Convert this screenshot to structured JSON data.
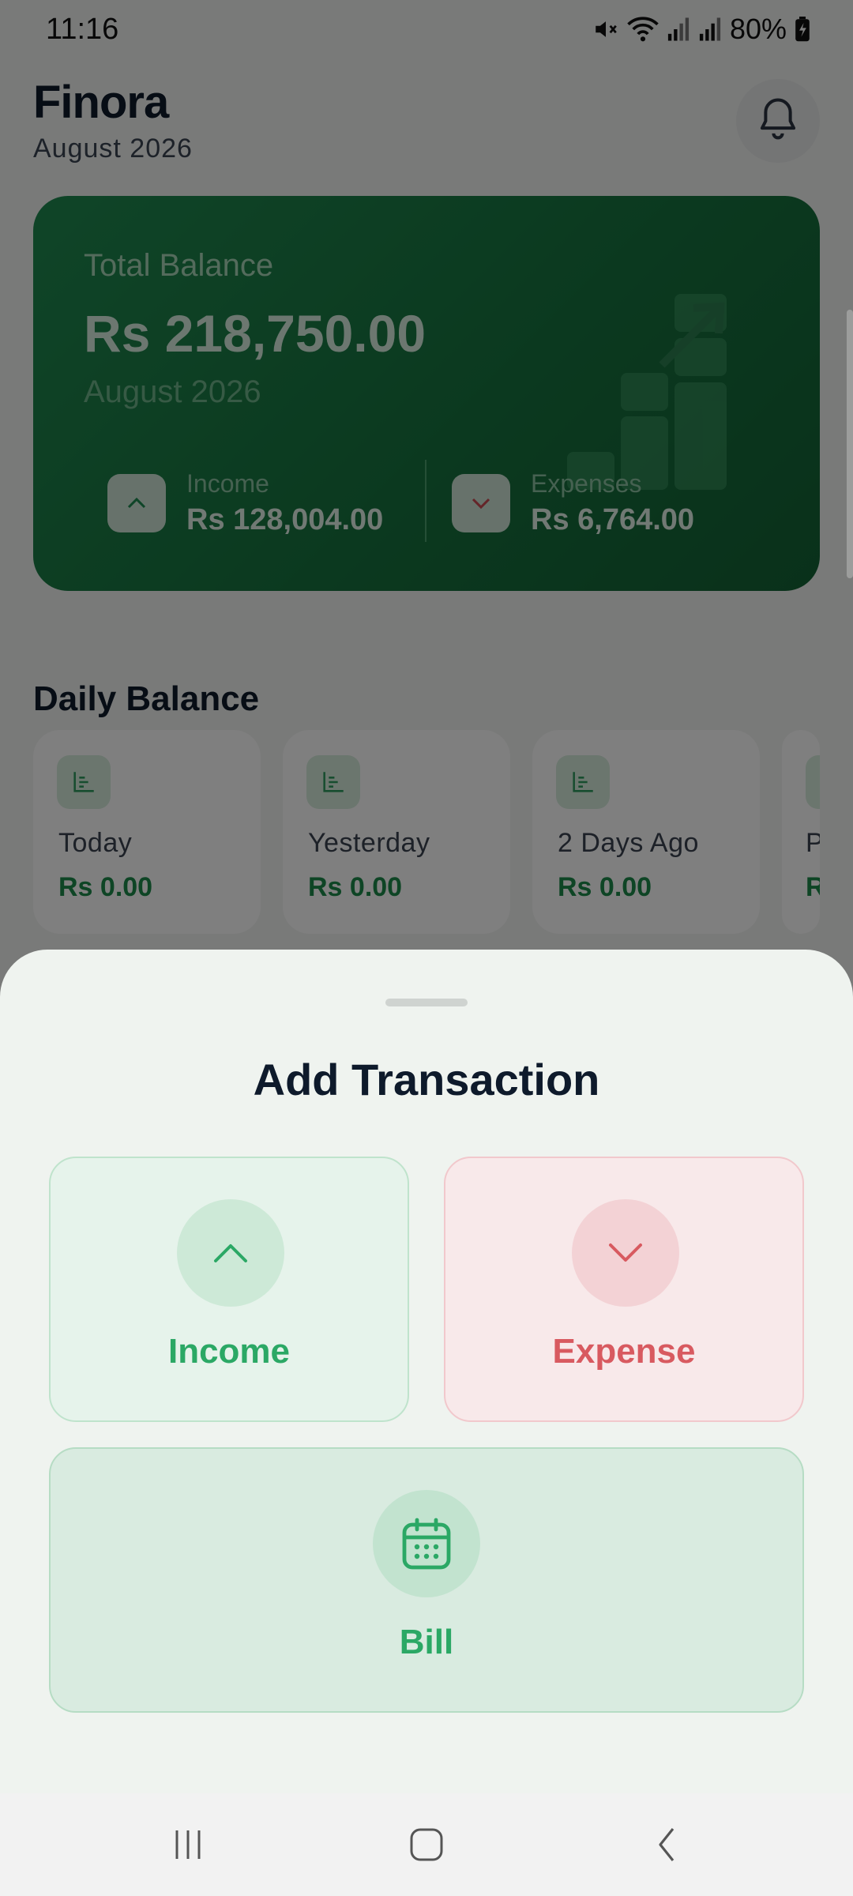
{
  "status_bar": {
    "time": "11:16",
    "battery": "80%",
    "icons": [
      "mute-icon",
      "wifi-icon",
      "signal-icon",
      "signal-icon",
      "battery-charging-icon"
    ]
  },
  "header": {
    "app_name": "Finora",
    "period": "August 2026",
    "notification_icon": "bell-icon"
  },
  "balance_card": {
    "label": "Total Balance",
    "amount": "Rs 218,750.00",
    "period": "August 2026",
    "income": {
      "label": "Income",
      "value": "Rs 128,004.00",
      "icon": "chevron-up-icon"
    },
    "expenses": {
      "label": "Expenses",
      "value": "Rs 6,764.00",
      "icon": "chevron-down-icon"
    },
    "accent": "#1f8a50"
  },
  "daily_balance": {
    "title": "Daily Balance",
    "cards": [
      {
        "label": "Today",
        "value": "Rs 0.00"
      },
      {
        "label": "Yesterday",
        "value": "Rs 0.00"
      },
      {
        "label": "2 Days Ago",
        "value": "Rs 0.00"
      },
      {
        "label": "P",
        "value": "R"
      }
    ]
  },
  "sheet": {
    "title": "Add Transaction",
    "options": {
      "income": {
        "label": "Income",
        "icon": "chevron-up-icon",
        "color": "#2ba865"
      },
      "expense": {
        "label": "Expense",
        "icon": "chevron-down-icon",
        "color": "#d85a60"
      },
      "bill": {
        "label": "Bill",
        "icon": "calendar-icon",
        "color": "#2ba865"
      }
    }
  },
  "nav_bar": {
    "buttons": [
      "recent-apps-icon",
      "home-icon",
      "back-icon"
    ]
  }
}
